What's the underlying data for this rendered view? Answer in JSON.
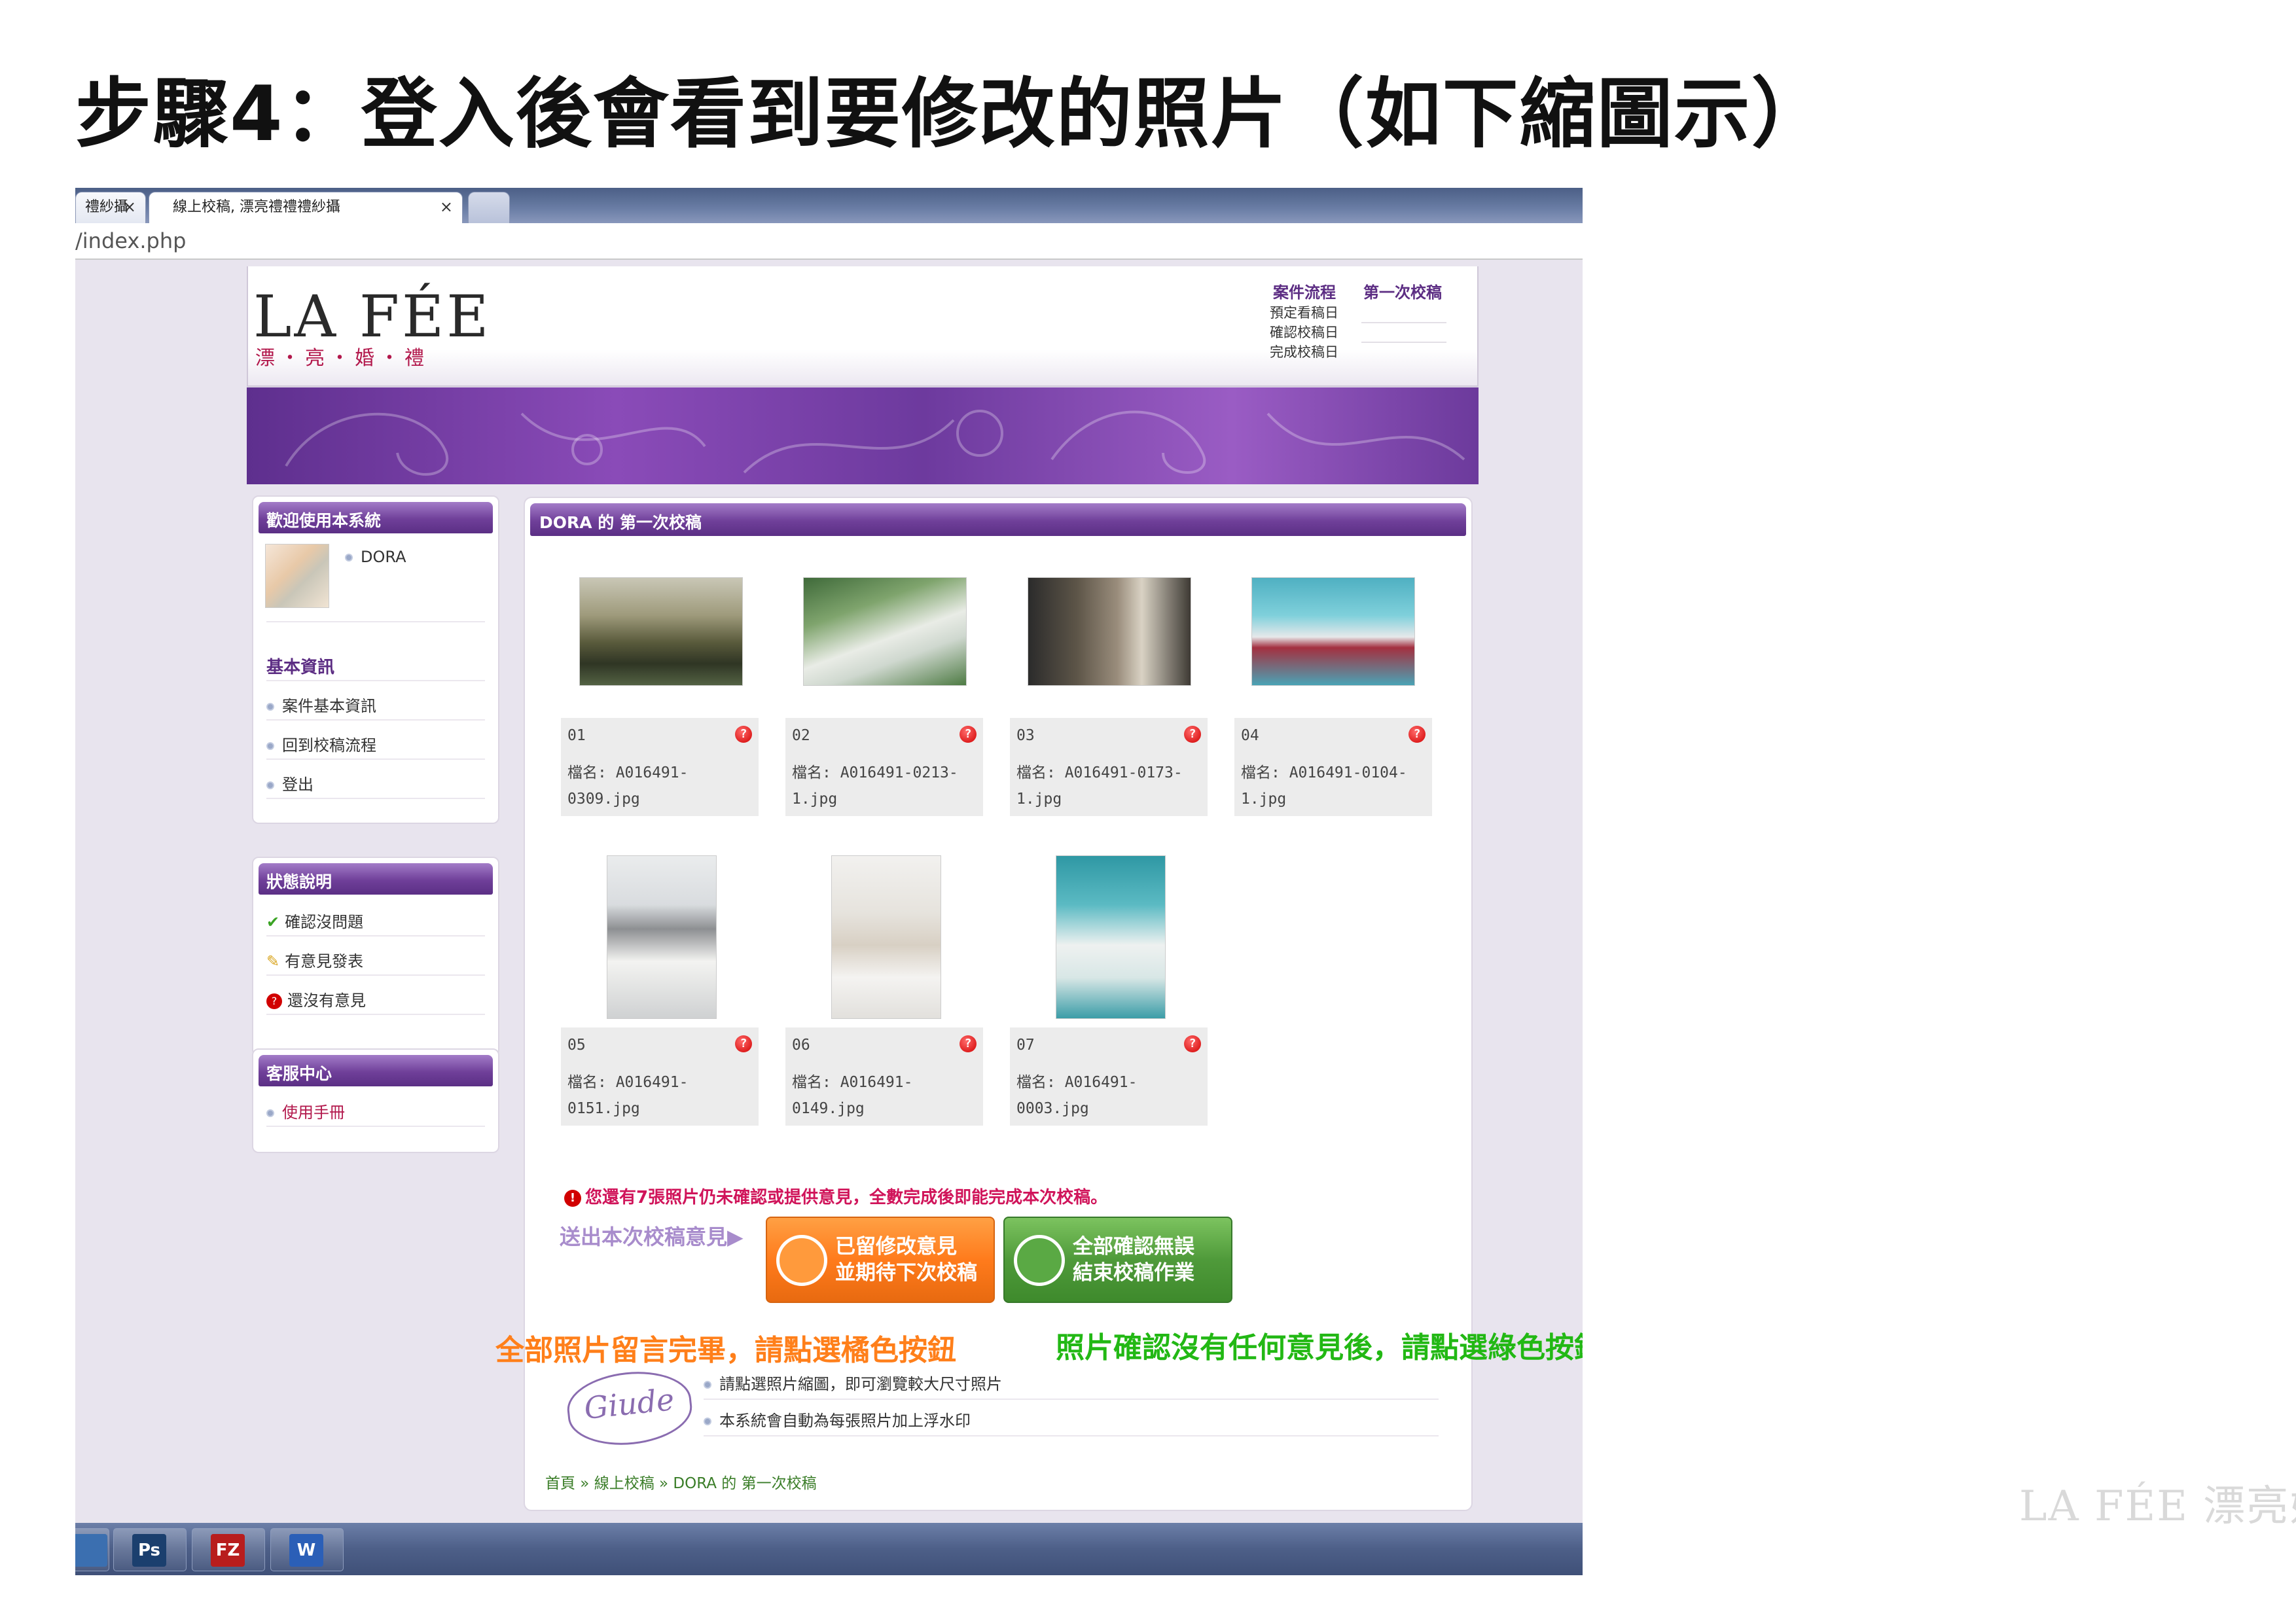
{
  "slide_title": "步驟4：登入後會看到要修改的照片（如下縮圖示）",
  "browser": {
    "tabs": [
      "禮紗攝",
      "線上校稿, 漂亮禮禮禮紗攝"
    ],
    "url": "/index.php"
  },
  "header": {
    "logo": "LA FÉE",
    "logo_sub": "漂・亮・婚・禮",
    "flow_title": "案件流程",
    "flow_stage": "第一次校稿",
    "flow_rows": [
      "預定看稿日",
      "確認校稿日",
      "完成校稿日"
    ]
  },
  "sidebar": {
    "welcome": {
      "title": "歡迎使用本系統",
      "user": "DORA"
    },
    "basic": {
      "title": "基本資訊",
      "items": [
        "案件基本資訊",
        "回到校稿流程",
        "登出"
      ]
    },
    "status": {
      "title": "狀態說明",
      "items": [
        "確認沒問題",
        "有意見發表",
        "還沒有意見"
      ]
    },
    "support": {
      "title": "客服中心",
      "items": [
        "使用手冊"
      ]
    }
  },
  "main": {
    "title": "DORA 的 第一次校稿",
    "photos": [
      {
        "num": "01",
        "file": "檔名: A016491-0309.jpg"
      },
      {
        "num": "02",
        "file": "檔名: A016491-0213-1.jpg"
      },
      {
        "num": "03",
        "file": "檔名: A016491-0173-1.jpg"
      },
      {
        "num": "04",
        "file": "檔名: A016491-0104-1.jpg"
      },
      {
        "num": "05",
        "file": "檔名: A016491-0151.jpg"
      },
      {
        "num": "06",
        "file": "檔名: A016491-0149.jpg"
      },
      {
        "num": "07",
        "file": "檔名: A016491-0003.jpg"
      }
    ],
    "warning": "您還有7張照片仍未確認或提供意見，全數完成後即能完成本次校稿。",
    "send_label": "送出本次校稿意見▶",
    "btn_orange": [
      "已留修改意見",
      "並期待下次校稿"
    ],
    "btn_green": [
      "全部確認無誤",
      "結束校稿作業"
    ],
    "guide_label": "Giude",
    "guide_lines": [
      "請點選照片縮圖，即可瀏覽較大尺寸照片",
      "本系統會自動為每張照片加上浮水印"
    ],
    "breadcrumb": "首頁 » 線上校稿 » DORA 的 第一次校稿"
  },
  "annotations": {
    "orange": "全部照片留言完畢，請點選橘色按鈕",
    "green": "照片確認沒有任何意見後，請點選綠色按鈕"
  },
  "watermark": "LA FÉE 漂亮婚紗",
  "taskbar": [
    "Ps",
    "FZ",
    "W"
  ],
  "colors": {
    "purple": "#6f3f99",
    "orange_btn": "#ff7b1c",
    "green_btn": "#4f9a3a",
    "alert_red": "#d10000"
  }
}
